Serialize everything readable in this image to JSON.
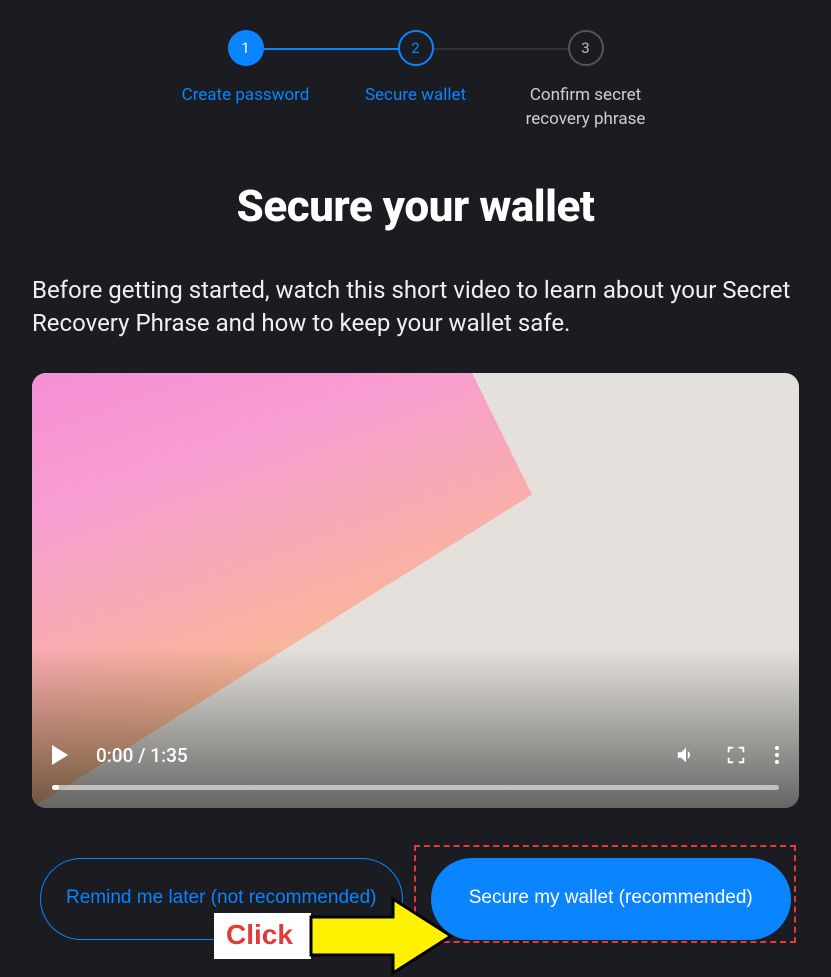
{
  "stepper": {
    "steps": [
      {
        "num": "1",
        "label": "Create password"
      },
      {
        "num": "2",
        "label": "Secure wallet"
      },
      {
        "num": "3",
        "label": "Confirm secret recovery phrase"
      }
    ]
  },
  "heading": "Secure your wallet",
  "intro": "Before getting started, watch this short video to learn about your Secret Recovery Phrase and how to keep your wallet safe.",
  "video": {
    "current_time": "0:00",
    "duration": "1:35"
  },
  "buttons": {
    "remind_later": "Remind me later (not recommended)",
    "secure_wallet": "Secure my wallet (recommended)"
  },
  "annotation": {
    "click_label": "Click"
  }
}
